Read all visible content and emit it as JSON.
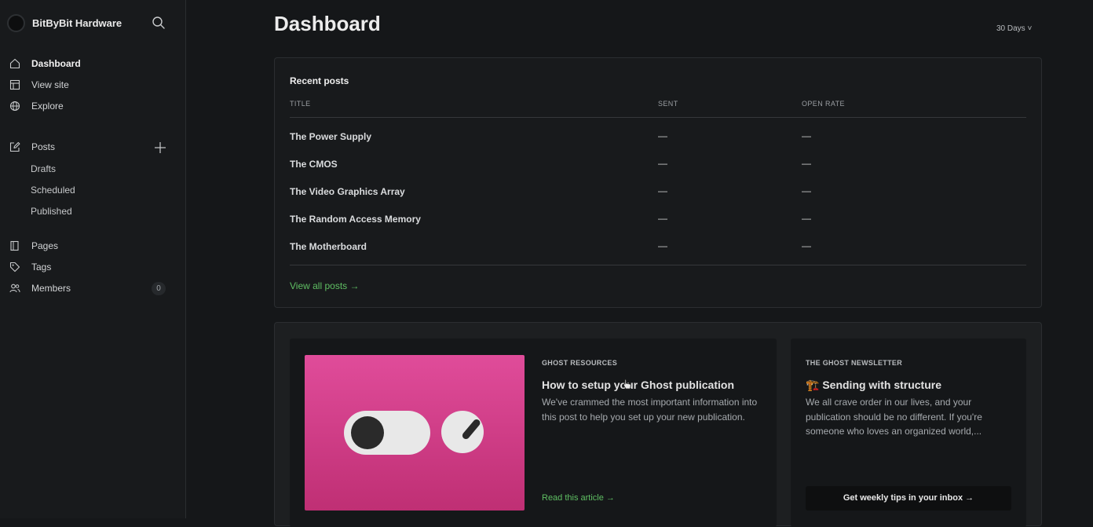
{
  "sidebar": {
    "site_name": "BitByBit Hardware",
    "nav": [
      {
        "label": "Dashboard",
        "icon": "home-icon",
        "active": true
      },
      {
        "label": "View site",
        "icon": "layout-icon"
      },
      {
        "label": "Explore",
        "icon": "globe-icon"
      }
    ],
    "posts": {
      "label": "Posts",
      "icon": "edit-icon",
      "subitems": [
        "Drafts",
        "Scheduled",
        "Published"
      ]
    },
    "pages_label": "Pages",
    "tags_label": "Tags",
    "members_label": "Members",
    "members_count": "0"
  },
  "header": {
    "title": "Dashboard",
    "range": "30 Days ˅"
  },
  "recent_posts": {
    "title": "Recent posts",
    "columns": [
      "TITLE",
      "SENT",
      "OPEN RATE"
    ],
    "rows": [
      {
        "title": "The Power Supply",
        "sent": "—",
        "open_rate": "—"
      },
      {
        "title": "The CMOS",
        "sent": "—",
        "open_rate": "—"
      },
      {
        "title": "The Video Graphics Array",
        "sent": "—",
        "open_rate": "—"
      },
      {
        "title": "The Random Access Memory",
        "sent": "—",
        "open_rate": "—"
      },
      {
        "title": "The Motherboard",
        "sent": "—",
        "open_rate": "—"
      }
    ],
    "view_all": "View all posts →"
  },
  "resources": {
    "kicker": "GHOST RESOURCES",
    "title": "How to setup your Ghost publication",
    "body": "We've crammed the most important information into this post to help you set up your new publication.",
    "link": "Read this article →"
  },
  "newsletter": {
    "kicker": "THE GHOST NEWSLETTER",
    "title": "🏗️ Sending with structure",
    "body": "We all crave order in our lives, and your publication should be no different. If you're someone who loves an organized world,...",
    "button": "Get weekly tips in your inbox →"
  },
  "colors": {
    "accent_green": "#5fbf63",
    "hero_pink": "#d63f88",
    "background": "#151719"
  }
}
